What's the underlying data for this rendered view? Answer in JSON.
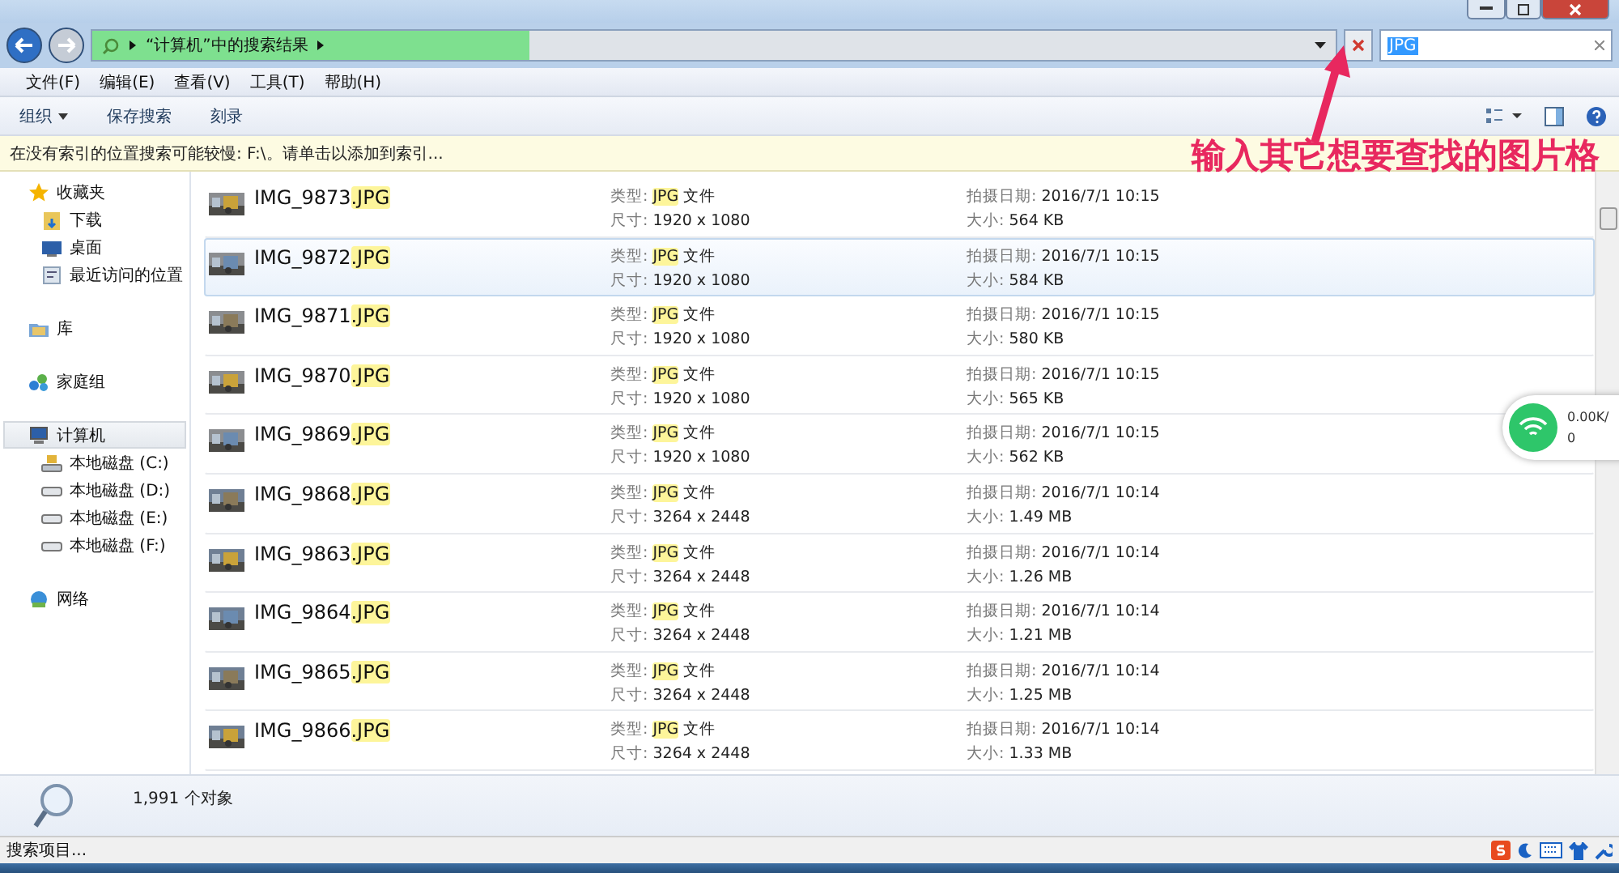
{
  "address_bar": {
    "crumbs": [
      "“计算机”中的搜索结果"
    ]
  },
  "search": {
    "value": "JPG"
  },
  "menu": [
    "文件(F)",
    "编辑(E)",
    "查看(V)",
    "工具(T)",
    "帮助(H)"
  ],
  "toolbar": [
    {
      "label": "组织",
      "kind": "dropdown"
    },
    {
      "label": "保存搜索",
      "kind": "plain"
    },
    {
      "label": "刻录",
      "kind": "plain"
    }
  ],
  "info_bar": "在没有索引的位置搜索可能较慢: F:\\。请单击以添加到索引...",
  "annotation": "输入其它想要查找的图片格",
  "sidebar": [
    {
      "label": "收藏夹",
      "kind": "star",
      "selected": false,
      "children": [
        {
          "label": "下载",
          "kind": "folder",
          "selected": false
        },
        {
          "label": "桌面",
          "kind": "desktop",
          "selected": false
        },
        {
          "label": "最近访问的位置",
          "kind": "recent",
          "selected": false
        }
      ]
    },
    {
      "label": "库",
      "kind": "library",
      "selected": false
    },
    {
      "label": "家庭组",
      "kind": "homegroup",
      "selected": false
    },
    {
      "label": "计算机",
      "kind": "computer",
      "selected": true,
      "children": [
        {
          "label": "本地磁盘 (C:)",
          "kind": "system-drive",
          "selected": false
        },
        {
          "label": "本地磁盘 (D:)",
          "kind": "drive",
          "selected": false
        },
        {
          "label": "本地磁盘 (E:)",
          "kind": "drive",
          "selected": false
        },
        {
          "label": "本地磁盘 (F:)",
          "kind": "drive",
          "selected": false
        }
      ]
    },
    {
      "label": "网络",
      "kind": "network",
      "selected": false
    }
  ],
  "files": [
    {
      "name": "IMG_9873",
      "match": ".JPG",
      "type_label": "类型:",
      "type_match": "JPG",
      "type_suffix": "文件",
      "dims_label": "尺寸:",
      "dims": "1920 x 1080",
      "date_label": "拍摄日期:",
      "date": "2016/7/1 10:15",
      "size_label": "大小:",
      "size": "564 KB",
      "selected": false
    },
    {
      "name": "IMG_9872",
      "match": ".JPG",
      "type_label": "类型:",
      "type_match": "JPG",
      "type_suffix": "文件",
      "dims_label": "尺寸:",
      "dims": "1920 x 1080",
      "date_label": "拍摄日期:",
      "date": "2016/7/1 10:15",
      "size_label": "大小:",
      "size": "584 KB",
      "selected": true
    },
    {
      "name": "IMG_9871",
      "match": ".JPG",
      "type_label": "类型:",
      "type_match": "JPG",
      "type_suffix": "文件",
      "dims_label": "尺寸:",
      "dims": "1920 x 1080",
      "date_label": "拍摄日期:",
      "date": "2016/7/1 10:15",
      "size_label": "大小:",
      "size": "580 KB",
      "selected": false
    },
    {
      "name": "IMG_9870",
      "match": ".JPG",
      "type_label": "类型:",
      "type_match": "JPG",
      "type_suffix": "文件",
      "dims_label": "尺寸:",
      "dims": "1920 x 1080",
      "date_label": "拍摄日期:",
      "date": "2016/7/1 10:15",
      "size_label": "大小:",
      "size": "565 KB",
      "selected": false
    },
    {
      "name": "IMG_9869",
      "match": ".JPG",
      "type_label": "类型:",
      "type_match": "JPG",
      "type_suffix": "文件",
      "dims_label": "尺寸:",
      "dims": "1920 x 1080",
      "date_label": "拍摄日期:",
      "date": "2016/7/1 10:15",
      "size_label": "大小:",
      "size": "562 KB",
      "selected": false
    },
    {
      "name": "IMG_9868",
      "match": ".JPG",
      "type_label": "类型:",
      "type_match": "JPG",
      "type_suffix": "文件",
      "dims_label": "尺寸:",
      "dims": "3264 x 2448",
      "date_label": "拍摄日期:",
      "date": "2016/7/1 10:14",
      "size_label": "大小:",
      "size": "1.49 MB",
      "selected": false
    },
    {
      "name": "IMG_9863",
      "match": ".JPG",
      "type_label": "类型:",
      "type_match": "JPG",
      "type_suffix": "文件",
      "dims_label": "尺寸:",
      "dims": "3264 x 2448",
      "date_label": "拍摄日期:",
      "date": "2016/7/1 10:14",
      "size_label": "大小:",
      "size": "1.26 MB",
      "selected": false
    },
    {
      "name": "IMG_9864",
      "match": ".JPG",
      "type_label": "类型:",
      "type_match": "JPG",
      "type_suffix": "文件",
      "dims_label": "尺寸:",
      "dims": "3264 x 2448",
      "date_label": "拍摄日期:",
      "date": "2016/7/1 10:14",
      "size_label": "大小:",
      "size": "1.21 MB",
      "selected": false
    },
    {
      "name": "IMG_9865",
      "match": ".JPG",
      "type_label": "类型:",
      "type_match": "JPG",
      "type_suffix": "文件",
      "dims_label": "尺寸:",
      "dims": "3264 x 2448",
      "date_label": "拍摄日期:",
      "date": "2016/7/1 10:14",
      "size_label": "大小:",
      "size": "1.25 MB",
      "selected": false
    },
    {
      "name": "IMG_9866",
      "match": ".JPG",
      "type_label": "类型:",
      "type_match": "JPG",
      "type_suffix": "文件",
      "dims_label": "尺寸:",
      "dims": "3264 x 2448",
      "date_label": "拍摄日期:",
      "date": "2016/7/1 10:14",
      "size_label": "大小:",
      "size": "1.33 MB",
      "selected": false
    }
  ],
  "details": {
    "count": "1,991 个对象"
  },
  "status_bar": {
    "text": "搜索项目..."
  },
  "net_widget": {
    "speed": "0.00K/",
    "count": "0"
  }
}
